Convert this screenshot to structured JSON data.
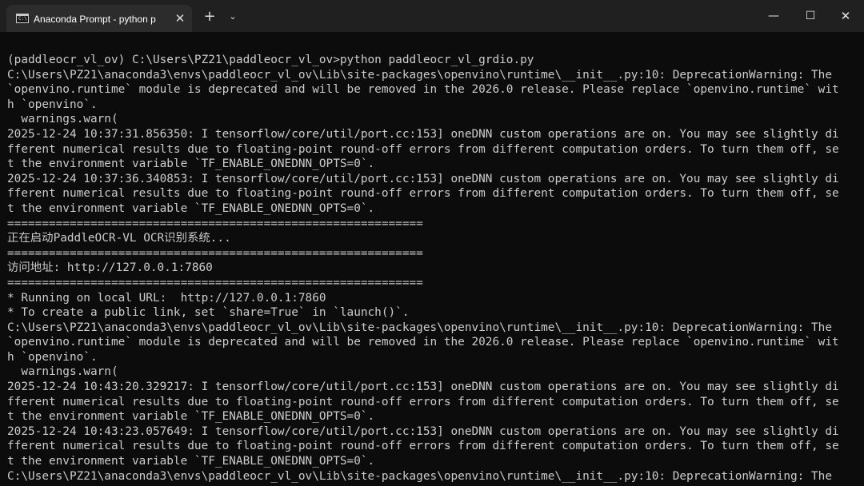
{
  "window": {
    "tab_title": "Anaconda Prompt - python  p",
    "tab_icon_text": "C:\\",
    "tab_close_glyph": "✕",
    "new_tab_glyph": "+",
    "dropdown_glyph": "⌄",
    "minimize_glyph": "—",
    "maximize_glyph": "☐",
    "close_glyph": "✕"
  },
  "terminal": {
    "foreground": "#cccccc",
    "background": "#0c0c0c",
    "lines": [
      "(paddleocr_vl_ov) C:\\Users\\PZ21\\paddleocr_vl_ov>python paddleocr_vl_grdio.py",
      "C:\\Users\\PZ21\\anaconda3\\envs\\paddleocr_vl_ov\\Lib\\site-packages\\openvino\\runtime\\__init__.py:10: DeprecationWarning: The",
      "`openvino.runtime` module is deprecated and will be removed in the 2026.0 release. Please replace `openvino.runtime` wit",
      "h `openvino`.",
      "  warnings.warn(",
      "2025-12-24 10:37:31.856350: I tensorflow/core/util/port.cc:153] oneDNN custom operations are on. You may see slightly di",
      "fferent numerical results due to floating-point round-off errors from different computation orders. To turn them off, se",
      "t the environment variable `TF_ENABLE_ONEDNN_OPTS=0`.",
      "2025-12-24 10:37:36.340853: I tensorflow/core/util/port.cc:153] oneDNN custom operations are on. You may see slightly di",
      "fferent numerical results due to floating-point round-off errors from different computation orders. To turn them off, se",
      "t the environment variable `TF_ENABLE_ONEDNN_OPTS=0`.",
      "============================================================",
      "正在启动PaddleOCR-VL OCR识别系统...",
      "============================================================",
      "访问地址: http://127.0.0.1:7860",
      "============================================================",
      "* Running on local URL:  http://127.0.0.1:7860",
      "* To create a public link, set `share=True` in `launch()`.",
      "C:\\Users\\PZ21\\anaconda3\\envs\\paddleocr_vl_ov\\Lib\\site-packages\\openvino\\runtime\\__init__.py:10: DeprecationWarning: The",
      "`openvino.runtime` module is deprecated and will be removed in the 2026.0 release. Please replace `openvino.runtime` wit",
      "h `openvino`.",
      "  warnings.warn(",
      "2025-12-24 10:43:20.329217: I tensorflow/core/util/port.cc:153] oneDNN custom operations are on. You may see slightly di",
      "fferent numerical results due to floating-point round-off errors from different computation orders. To turn them off, se",
      "t the environment variable `TF_ENABLE_ONEDNN_OPTS=0`.",
      "2025-12-24 10:43:23.057649: I tensorflow/core/util/port.cc:153] oneDNN custom operations are on. You may see slightly di",
      "fferent numerical results due to floating-point round-off errors from different computation orders. To turn them off, se",
      "t the environment variable `TF_ENABLE_ONEDNN_OPTS=0`.",
      "C:\\Users\\PZ21\\anaconda3\\envs\\paddleocr_vl_ov\\Lib\\site-packages\\openvino\\runtime\\__init__.py:10: DeprecationWarning: The"
    ]
  }
}
